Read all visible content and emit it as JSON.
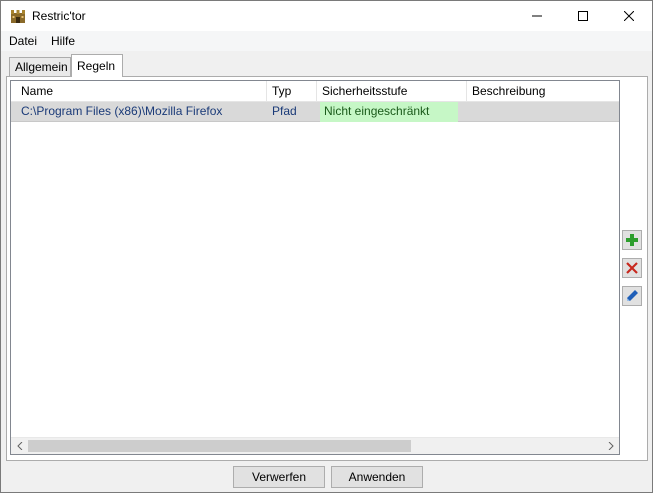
{
  "window": {
    "title": "Restric'tor",
    "app_icon": "castle-icon",
    "controls": [
      "minimize-icon",
      "maximize-icon",
      "close-icon"
    ]
  },
  "menu": {
    "items": [
      {
        "label": "Datei"
      },
      {
        "label": "Hilfe"
      }
    ]
  },
  "tabs": [
    {
      "label": "Allgemein",
      "selected": false
    },
    {
      "label": "Regeln",
      "selected": true
    }
  ],
  "rules_table": {
    "columns": [
      "Name",
      "Typ",
      "Sicherheitsstufe",
      "Beschreibung"
    ],
    "rows": [
      {
        "name": "C:\\Program Files (x86)\\Mozilla Firefox",
        "typ": "Pfad",
        "sicherheitsstufe": "Nicht eingeschränkt",
        "beschreibung": "",
        "selected": true
      }
    ]
  },
  "side_actions": [
    {
      "icon": "plus-icon",
      "color": "#2e9e2e"
    },
    {
      "icon": "delete-x-icon",
      "color": "#c8281e"
    },
    {
      "icon": "pencil-icon",
      "color": "#1f5fb8"
    }
  ],
  "buttons": {
    "discard_label": "Verwerfen",
    "apply_label": "Anwenden"
  },
  "colors": {
    "level_unrestricted_bg": "#c6f7c6",
    "selected_row_bg": "#d9d9d9",
    "link_text": "#1a3a78"
  }
}
